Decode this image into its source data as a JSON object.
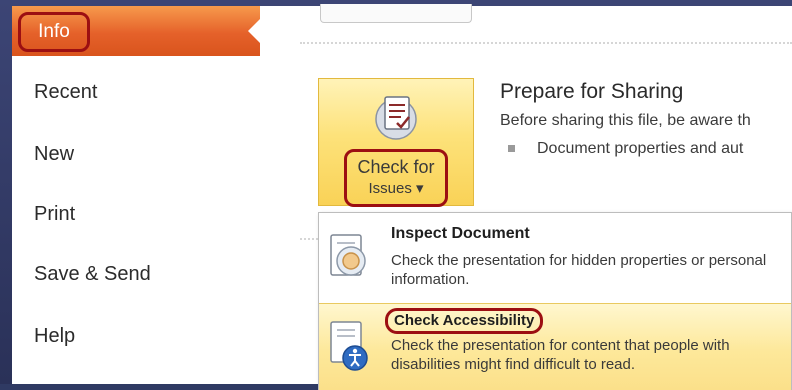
{
  "sidebar": {
    "active": "Info",
    "items": [
      {
        "label": "Recent"
      },
      {
        "label": "New"
      },
      {
        "label": "Print"
      },
      {
        "label": "Save & Send"
      },
      {
        "label": "Help"
      }
    ]
  },
  "main": {
    "check_issues": {
      "line1": "Check for",
      "line2": "Issues ▾"
    },
    "prepare": {
      "title": "Prepare for Sharing",
      "description": "Before sharing this file, be aware th",
      "bullet": "Document properties and aut"
    },
    "dropdown": [
      {
        "title": "Inspect Document",
        "description": "Check the presentation for hidden properties or personal information."
      },
      {
        "title": "Check Accessibility",
        "description": "Check the presentation for content that people with disabilities might find difficult to read."
      }
    ]
  },
  "colors": {
    "info_tab": "#e5612a",
    "highlight_outline": "#9c0f12",
    "button_yellow": "#fde27a",
    "frame": "#2f3a63"
  }
}
